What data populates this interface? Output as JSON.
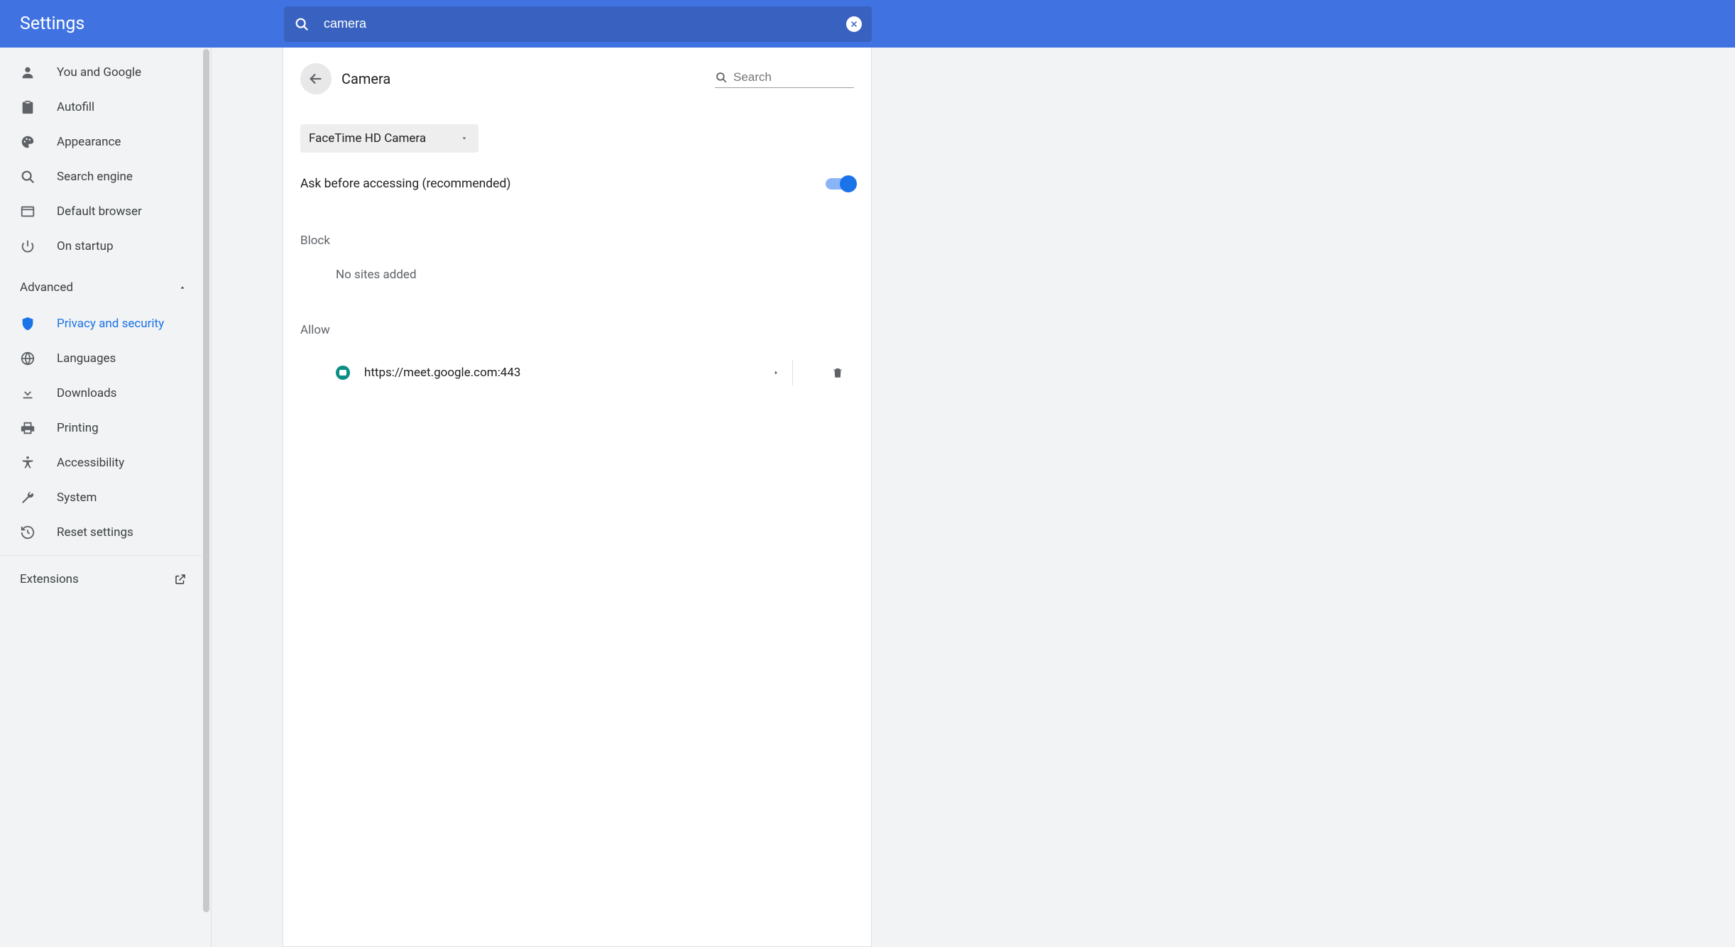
{
  "header": {
    "title": "Settings",
    "search_value": "camera"
  },
  "sidebar": {
    "items": [
      {
        "icon": "person",
        "label": "You and Google"
      },
      {
        "icon": "clipboard",
        "label": "Autofill"
      },
      {
        "icon": "palette",
        "label": "Appearance"
      },
      {
        "icon": "search",
        "label": "Search engine"
      },
      {
        "icon": "browser",
        "label": "Default browser"
      },
      {
        "icon": "power",
        "label": "On startup"
      }
    ],
    "advanced_label": "Advanced",
    "adv_items": [
      {
        "icon": "shield",
        "label": "Privacy and security",
        "active": true
      },
      {
        "icon": "globe",
        "label": "Languages"
      },
      {
        "icon": "download",
        "label": "Downloads"
      },
      {
        "icon": "printer",
        "label": "Printing"
      },
      {
        "icon": "accessibility",
        "label": "Accessibility"
      },
      {
        "icon": "wrench",
        "label": "System"
      },
      {
        "icon": "restore",
        "label": "Reset settings"
      }
    ],
    "footer_label": "Extensions"
  },
  "page": {
    "title": "Camera",
    "search_placeholder": "Search",
    "camera_selected": "FaceTime HD Camera",
    "toggle_label": "Ask before accessing (recommended)",
    "block_label": "Block",
    "block_empty": "No sites added",
    "allow_label": "Allow",
    "allow_sites": [
      {
        "url": "https://meet.google.com:443"
      }
    ]
  }
}
